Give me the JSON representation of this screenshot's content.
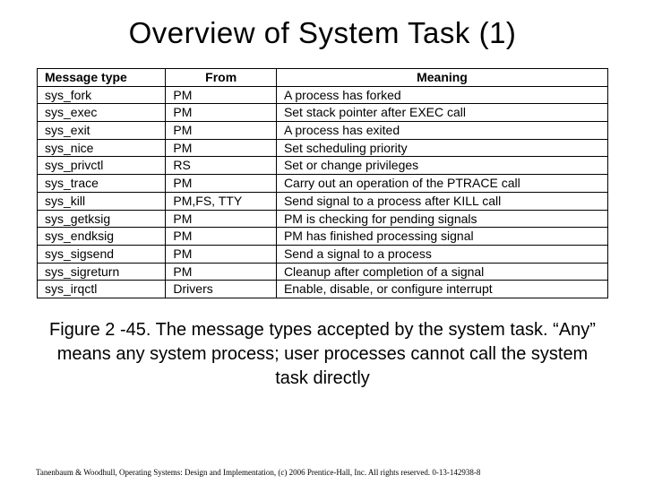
{
  "title": "Overview of System Task (1)",
  "headers": {
    "col1": "Message type",
    "col2": "From",
    "col3": "Meaning"
  },
  "rows": [
    {
      "type": "sys_fork",
      "from": "PM",
      "meaning": "A process has forked"
    },
    {
      "type": "sys_exec",
      "from": "PM",
      "meaning": "Set stack pointer after EXEC call"
    },
    {
      "type": "sys_exit",
      "from": "PM",
      "meaning": "A process has exited"
    },
    {
      "type": "sys_nice",
      "from": "PM",
      "meaning": "Set scheduling priority"
    },
    {
      "type": "sys_privctl",
      "from": "RS",
      "meaning": "Set or change privileges"
    },
    {
      "type": "sys_trace",
      "from": "PM",
      "meaning": "Carry out an operation of the PTRACE call"
    },
    {
      "type": "sys_kill",
      "from": "PM,FS, TTY",
      "meaning": "Send signal to a process after KILL call"
    },
    {
      "type": "sys_getksig",
      "from": "PM",
      "meaning": "PM is checking for pending signals"
    },
    {
      "type": "sys_endksig",
      "from": "PM",
      "meaning": "PM has finished processing signal"
    },
    {
      "type": "sys_sigsend",
      "from": "PM",
      "meaning": "Send a signal to a process"
    },
    {
      "type": "sys_sigreturn",
      "from": "PM",
      "meaning": "Cleanup after completion of a signal"
    },
    {
      "type": "sys_irqctl",
      "from": "Drivers",
      "meaning": "Enable, disable, or configure interrupt"
    }
  ],
  "caption": "Figure 2 -45. The message types accepted by the system task. “Any” means any system process; user processes cannot call the system task directly",
  "footer": "Tanenbaum & Woodhull, Operating Systems: Design and Implementation, (c) 2006 Prentice-Hall, Inc. All rights reserved. 0-13-142938-8"
}
